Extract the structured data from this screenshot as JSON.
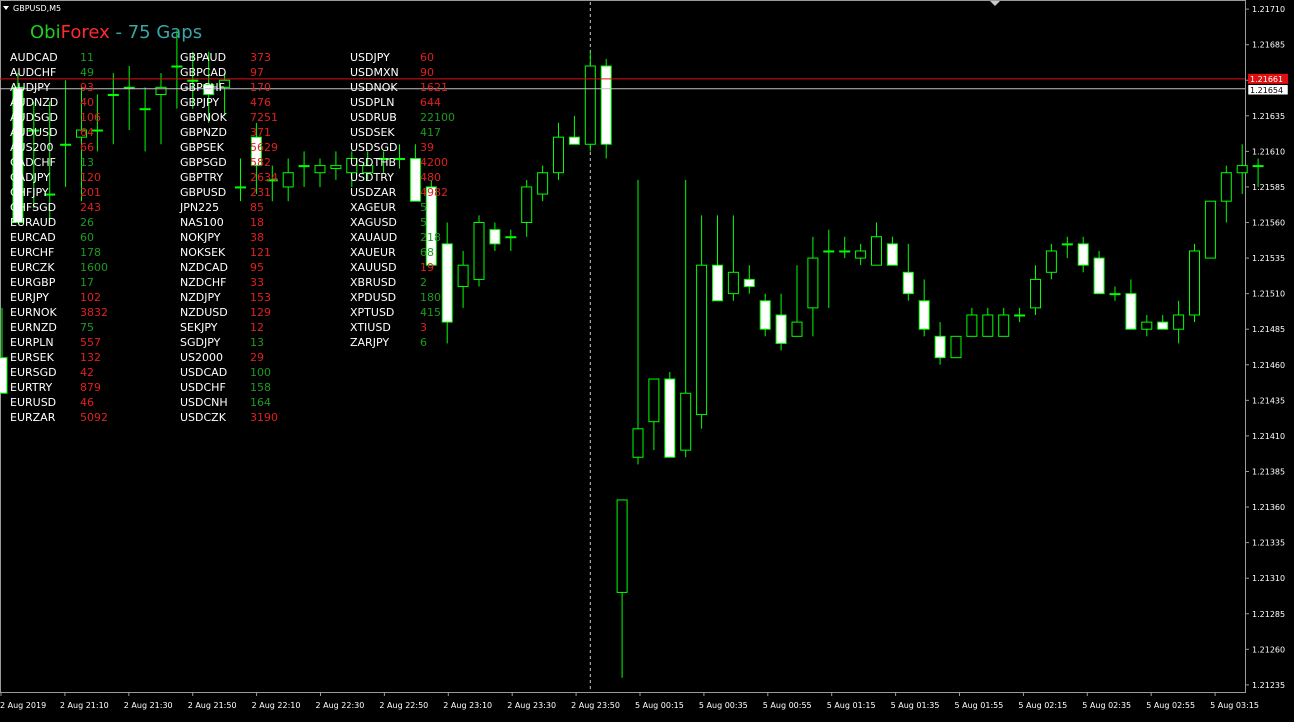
{
  "window": {
    "title": "GBPUSD,M5"
  },
  "overlay": {
    "title_part1": "Obi",
    "title_part2": "Forex",
    "title_part3": " - 75 Gaps",
    "colors": {
      "obi": "#22cc22",
      "forex": "#ff2b2b",
      "gaps": "#3aa6a6",
      "positive": "#1e9b1e",
      "negative": "#e02020",
      "symbol": "#ffffff"
    },
    "columns": [
      [
        {
          "symbol": "AUDCAD",
          "gap": "11",
          "dir": "up"
        },
        {
          "symbol": "AUDCHF",
          "gap": "49",
          "dir": "up"
        },
        {
          "symbol": "AUDJPY",
          "gap": "93",
          "dir": "down"
        },
        {
          "symbol": "AUDNZD",
          "gap": "40",
          "dir": "down"
        },
        {
          "symbol": "AUDSGD",
          "gap": "106",
          "dir": "down"
        },
        {
          "symbol": "AUDUSD",
          "gap": "64",
          "dir": "down"
        },
        {
          "symbol": "AUS200",
          "gap": "66",
          "dir": "down"
        },
        {
          "symbol": "CADCHF",
          "gap": "13",
          "dir": "up"
        },
        {
          "symbol": "CADJPY",
          "gap": "120",
          "dir": "down"
        },
        {
          "symbol": "CHFJPY",
          "gap": "201",
          "dir": "down"
        },
        {
          "symbol": "CHFSGD",
          "gap": "243",
          "dir": "down"
        },
        {
          "symbol": "EURAUD",
          "gap": "26",
          "dir": "up"
        },
        {
          "symbol": "EURCAD",
          "gap": "60",
          "dir": "up"
        },
        {
          "symbol": "EURCHF",
          "gap": "178",
          "dir": "up"
        },
        {
          "symbol": "EURCZK",
          "gap": "1600",
          "dir": "up"
        },
        {
          "symbol": "EURGBP",
          "gap": "17",
          "dir": "up"
        },
        {
          "symbol": "EURJPY",
          "gap": "102",
          "dir": "down"
        },
        {
          "symbol": "EURNOK",
          "gap": "3832",
          "dir": "down"
        },
        {
          "symbol": "EURNZD",
          "gap": "75",
          "dir": "up"
        },
        {
          "symbol": "EURPLN",
          "gap": "557",
          "dir": "down"
        },
        {
          "symbol": "EURSEK",
          "gap": "132",
          "dir": "down"
        },
        {
          "symbol": "EURSGD",
          "gap": "42",
          "dir": "down"
        },
        {
          "symbol": "EURTRY",
          "gap": "879",
          "dir": "down"
        },
        {
          "symbol": "EURUSD",
          "gap": "46",
          "dir": "down"
        },
        {
          "symbol": "EURZAR",
          "gap": "5092",
          "dir": "down"
        }
      ],
      [
        {
          "symbol": "GBPAUD",
          "gap": "373",
          "dir": "down"
        },
        {
          "symbol": "GBPCAD",
          "gap": "97",
          "dir": "down"
        },
        {
          "symbol": "GBPCHF",
          "gap": "170",
          "dir": "down"
        },
        {
          "symbol": "GBPJPY",
          "gap": "476",
          "dir": "down"
        },
        {
          "symbol": "GBPNOK",
          "gap": "7251",
          "dir": "down"
        },
        {
          "symbol": "GBPNZD",
          "gap": "371",
          "dir": "down"
        },
        {
          "symbol": "GBPSEK",
          "gap": "5629",
          "dir": "down"
        },
        {
          "symbol": "GBPSGD",
          "gap": "582",
          "dir": "down"
        },
        {
          "symbol": "GBPTRY",
          "gap": "2634",
          "dir": "down"
        },
        {
          "symbol": "GBPUSD",
          "gap": "231",
          "dir": "down"
        },
        {
          "symbol": "JPN225",
          "gap": "85",
          "dir": "down"
        },
        {
          "symbol": "NAS100",
          "gap": "18",
          "dir": "down"
        },
        {
          "symbol": "NOKJPY",
          "gap": "38",
          "dir": "down"
        },
        {
          "symbol": "NOKSEK",
          "gap": "121",
          "dir": "down"
        },
        {
          "symbol": "NZDCAD",
          "gap": "95",
          "dir": "down"
        },
        {
          "symbol": "NZDCHF",
          "gap": "33",
          "dir": "down"
        },
        {
          "symbol": "NZDJPY",
          "gap": "153",
          "dir": "down"
        },
        {
          "symbol": "NZDUSD",
          "gap": "129",
          "dir": "down"
        },
        {
          "symbol": "SEKJPY",
          "gap": "12",
          "dir": "down"
        },
        {
          "symbol": "SGDJPY",
          "gap": "13",
          "dir": "up"
        },
        {
          "symbol": "US2000",
          "gap": "29",
          "dir": "down"
        },
        {
          "symbol": "USDCAD",
          "gap": "100",
          "dir": "up"
        },
        {
          "symbol": "USDCHF",
          "gap": "158",
          "dir": "up"
        },
        {
          "symbol": "USDCNH",
          "gap": "164",
          "dir": "up"
        },
        {
          "symbol": "USDCZK",
          "gap": "3190",
          "dir": "down"
        }
      ],
      [
        {
          "symbol": "USDJPY",
          "gap": "60",
          "dir": "down"
        },
        {
          "symbol": "USDMXN",
          "gap": "90",
          "dir": "down"
        },
        {
          "symbol": "USDNOK",
          "gap": "1621",
          "dir": "down"
        },
        {
          "symbol": "USDPLN",
          "gap": "644",
          "dir": "down"
        },
        {
          "symbol": "USDRUB",
          "gap": "22100",
          "dir": "up"
        },
        {
          "symbol": "USDSEK",
          "gap": "417",
          "dir": "up"
        },
        {
          "symbol": "USDSGD",
          "gap": "39",
          "dir": "down"
        },
        {
          "symbol": "USDTHB",
          "gap": "4200",
          "dir": "down"
        },
        {
          "symbol": "USDTRY",
          "gap": "480",
          "dir": "down"
        },
        {
          "symbol": "USDZAR",
          "gap": "4982",
          "dir": "down"
        },
        {
          "symbol": "XAGEUR",
          "gap": "5",
          "dir": "up"
        },
        {
          "symbol": "XAGUSD",
          "gap": "5",
          "dir": "up"
        },
        {
          "symbol": "XAUAUD",
          "gap": "218",
          "dir": "up"
        },
        {
          "symbol": "XAUEUR",
          "gap": "68",
          "dir": "up"
        },
        {
          "symbol": "XAUUSD",
          "gap": "19",
          "dir": "down"
        },
        {
          "symbol": "XBRUSD",
          "gap": "2",
          "dir": "up"
        },
        {
          "symbol": "XPDUSD",
          "gap": "180",
          "dir": "up"
        },
        {
          "symbol": "XPTUSD",
          "gap": "415",
          "dir": "up"
        },
        {
          "symbol": "XTIUSD",
          "gap": "3",
          "dir": "down"
        },
        {
          "symbol": "ZARJPY",
          "gap": "6",
          "dir": "up"
        }
      ]
    ]
  },
  "price_labels": {
    "bid": "1.21661",
    "last": "1.21654",
    "bid_color": "#e01010",
    "last_color": "#ffffff"
  },
  "chart_data": {
    "type": "candlestick",
    "symbol": "GBPUSD",
    "timeframe": "M5",
    "bull_color": "#000000",
    "bear_color": "#ffffff",
    "wick_color": "#00ff00",
    "ylim": [
      1.2123,
      1.21715
    ],
    "y_ticks": [
      "1.21235",
      "1.21260",
      "1.21285",
      "1.21310",
      "1.21335",
      "1.21360",
      "1.21385",
      "1.21410",
      "1.21435",
      "1.21460",
      "1.21485",
      "1.21510",
      "1.21535",
      "1.21560",
      "1.21585",
      "1.21610",
      "1.21635",
      "1.21660",
      "1.21685",
      "1.21710"
    ],
    "x_ticks": [
      "2 Aug 2019",
      "2 Aug 21:10",
      "2 Aug 21:30",
      "2 Aug 21:50",
      "2 Aug 22:10",
      "2 Aug 22:30",
      "2 Aug 22:50",
      "2 Aug 23:10",
      "2 Aug 23:30",
      "2 Aug 23:50",
      "5 Aug 00:15",
      "5 Aug 00:35",
      "5 Aug 00:55",
      "5 Aug 01:15",
      "5 Aug 01:35",
      "5 Aug 01:55",
      "5 Aug 02:15",
      "5 Aug 02:35",
      "5 Aug 02:55",
      "5 Aug 03:15"
    ],
    "separator_time": "5 Aug 00:00",
    "candles": [
      {
        "o": 1.21465,
        "h": 1.215,
        "l": 1.2144,
        "c": 1.2144
      },
      {
        "o": 1.21655,
        "h": 1.21665,
        "l": 1.2156,
        "c": 1.2156
      },
      {
        "o": 1.21625,
        "h": 1.21645,
        "l": 1.2157,
        "c": 1.21625
      },
      {
        "o": 1.2158,
        "h": 1.21645,
        "l": 1.2156,
        "c": 1.2158
      },
      {
        "o": 1.21615,
        "h": 1.2166,
        "l": 1.21585,
        "c": 1.21615
      },
      {
        "o": 1.2162,
        "h": 1.21655,
        "l": 1.21575,
        "c": 1.21625
      },
      {
        "o": 1.21625,
        "h": 1.2165,
        "l": 1.2161,
        "c": 1.21625
      },
      {
        "o": 1.2165,
        "h": 1.21665,
        "l": 1.21615,
        "c": 1.2165
      },
      {
        "o": 1.21655,
        "h": 1.2167,
        "l": 1.21625,
        "c": 1.21655
      },
      {
        "o": 1.2164,
        "h": 1.21655,
        "l": 1.2161,
        "c": 1.2164
      },
      {
        "o": 1.2165,
        "h": 1.21665,
        "l": 1.21615,
        "c": 1.21655
      },
      {
        "o": 1.2167,
        "h": 1.21695,
        "l": 1.2164,
        "c": 1.2167
      },
      {
        "o": 1.2166,
        "h": 1.2168,
        "l": 1.2164,
        "c": 1.2166
      },
      {
        "o": 1.21657,
        "h": 1.2168,
        "l": 1.2163,
        "c": 1.2165
      },
      {
        "o": 1.21655,
        "h": 1.21665,
        "l": 1.21635,
        "c": 1.2166
      },
      {
        "o": 1.21585,
        "h": 1.21605,
        "l": 1.21575,
        "c": 1.21585
      },
      {
        "o": 1.2162,
        "h": 1.2163,
        "l": 1.2158,
        "c": 1.216
      },
      {
        "o": 1.2159,
        "h": 1.216,
        "l": 1.21575,
        "c": 1.2159
      },
      {
        "o": 1.21585,
        "h": 1.21605,
        "l": 1.21575,
        "c": 1.21595
      },
      {
        "o": 1.216,
        "h": 1.2161,
        "l": 1.21585,
        "c": 1.216
      },
      {
        "o": 1.21595,
        "h": 1.21605,
        "l": 1.21585,
        "c": 1.216
      },
      {
        "o": 1.21598,
        "h": 1.2161,
        "l": 1.2159,
        "c": 1.216
      },
      {
        "o": 1.21595,
        "h": 1.2161,
        "l": 1.21585,
        "c": 1.21605
      },
      {
        "o": 1.21595,
        "h": 1.2161,
        "l": 1.2159,
        "c": 1.216
      },
      {
        "o": 1.21605,
        "h": 1.2161,
        "l": 1.21595,
        "c": 1.21605
      },
      {
        "o": 1.21605,
        "h": 1.21615,
        "l": 1.21598,
        "c": 1.21605
      },
      {
        "o": 1.21605,
        "h": 1.21615,
        "l": 1.2158,
        "c": 1.21575
      },
      {
        "o": 1.21585,
        "h": 1.2159,
        "l": 1.2153,
        "c": 1.2153
      },
      {
        "o": 1.21545,
        "h": 1.2156,
        "l": 1.21475,
        "c": 1.2149
      },
      {
        "o": 1.21515,
        "h": 1.2154,
        "l": 1.215,
        "c": 1.2153
      },
      {
        "o": 1.2152,
        "h": 1.21565,
        "l": 1.21515,
        "c": 1.2156
      },
      {
        "o": 1.21555,
        "h": 1.2156,
        "l": 1.2154,
        "c": 1.21545
      },
      {
        "o": 1.2155,
        "h": 1.21555,
        "l": 1.2154,
        "c": 1.2155
      },
      {
        "o": 1.2156,
        "h": 1.2159,
        "l": 1.2155,
        "c": 1.21585
      },
      {
        "o": 1.2158,
        "h": 1.216,
        "l": 1.21575,
        "c": 1.21595
      },
      {
        "o": 1.21595,
        "h": 1.2163,
        "l": 1.2159,
        "c": 1.2162
      },
      {
        "o": 1.2162,
        "h": 1.21635,
        "l": 1.21615,
        "c": 1.21615
      },
      {
        "o": 1.21615,
        "h": 1.2168,
        "l": 1.2161,
        "c": 1.2167
      },
      {
        "o": 1.2167,
        "h": 1.21675,
        "l": 1.21605,
        "c": 1.21615
      },
      {
        "o": 1.213,
        "h": 1.21365,
        "l": 1.2124,
        "c": 1.21365
      },
      {
        "o": 1.21395,
        "h": 1.2159,
        "l": 1.2139,
        "c": 1.21415
      },
      {
        "o": 1.2142,
        "h": 1.2145,
        "l": 1.214,
        "c": 1.2145
      },
      {
        "o": 1.2145,
        "h": 1.21455,
        "l": 1.21395,
        "c": 1.21395
      },
      {
        "o": 1.214,
        "h": 1.2159,
        "l": 1.21395,
        "c": 1.2144
      },
      {
        "o": 1.21425,
        "h": 1.21565,
        "l": 1.21415,
        "c": 1.2153
      },
      {
        "o": 1.2153,
        "h": 1.21565,
        "l": 1.2151,
        "c": 1.21505
      },
      {
        "o": 1.2151,
        "h": 1.21565,
        "l": 1.21505,
        "c": 1.21525
      },
      {
        "o": 1.2152,
        "h": 1.2153,
        "l": 1.2151,
        "c": 1.21515
      },
      {
        "o": 1.21505,
        "h": 1.2151,
        "l": 1.2148,
        "c": 1.21485
      },
      {
        "o": 1.21495,
        "h": 1.2151,
        "l": 1.2147,
        "c": 1.21475
      },
      {
        "o": 1.2148,
        "h": 1.2153,
        "l": 1.2148,
        "c": 1.2149
      },
      {
        "o": 1.215,
        "h": 1.2155,
        "l": 1.2148,
        "c": 1.21535
      },
      {
        "o": 1.2154,
        "h": 1.21555,
        "l": 1.215,
        "c": 1.2154
      },
      {
        "o": 1.2154,
        "h": 1.2155,
        "l": 1.21535,
        "c": 1.2154
      },
      {
        "o": 1.21535,
        "h": 1.21545,
        "l": 1.2153,
        "c": 1.2154
      },
      {
        "o": 1.2153,
        "h": 1.2156,
        "l": 1.2153,
        "c": 1.2155
      },
      {
        "o": 1.21545,
        "h": 1.2155,
        "l": 1.2153,
        "c": 1.2153
      },
      {
        "o": 1.21525,
        "h": 1.21545,
        "l": 1.21505,
        "c": 1.2151
      },
      {
        "o": 1.21505,
        "h": 1.2152,
        "l": 1.2148,
        "c": 1.21485
      },
      {
        "o": 1.2148,
        "h": 1.2149,
        "l": 1.2146,
        "c": 1.21465
      },
      {
        "o": 1.21465,
        "h": 1.2148,
        "l": 1.21465,
        "c": 1.2148
      },
      {
        "o": 1.2148,
        "h": 1.215,
        "l": 1.2148,
        "c": 1.21495
      },
      {
        "o": 1.2148,
        "h": 1.215,
        "l": 1.2148,
        "c": 1.21495
      },
      {
        "o": 1.2148,
        "h": 1.215,
        "l": 1.2148,
        "c": 1.21495
      },
      {
        "o": 1.21495,
        "h": 1.215,
        "l": 1.2149,
        "c": 1.21495
      },
      {
        "o": 1.215,
        "h": 1.2153,
        "l": 1.21495,
        "c": 1.2152
      },
      {
        "o": 1.21525,
        "h": 1.21545,
        "l": 1.2152,
        "c": 1.2154
      },
      {
        "o": 1.21545,
        "h": 1.2155,
        "l": 1.21535,
        "c": 1.21545
      },
      {
        "o": 1.21545,
        "h": 1.2155,
        "l": 1.21525,
        "c": 1.2153
      },
      {
        "o": 1.21535,
        "h": 1.2154,
        "l": 1.2151,
        "c": 1.2151
      },
      {
        "o": 1.2151,
        "h": 1.21515,
        "l": 1.21505,
        "c": 1.2151
      },
      {
        "o": 1.2151,
        "h": 1.2152,
        "l": 1.21485,
        "c": 1.21485
      },
      {
        "o": 1.21485,
        "h": 1.21495,
        "l": 1.2148,
        "c": 1.2149
      },
      {
        "o": 1.2149,
        "h": 1.21495,
        "l": 1.21485,
        "c": 1.21485
      },
      {
        "o": 1.21485,
        "h": 1.21505,
        "l": 1.21475,
        "c": 1.21495
      },
      {
        "o": 1.21495,
        "h": 1.21545,
        "l": 1.2149,
        "c": 1.2154
      },
      {
        "o": 1.21535,
        "h": 1.21575,
        "l": 1.21535,
        "c": 1.21575
      },
      {
        "o": 1.21575,
        "h": 1.216,
        "l": 1.2156,
        "c": 1.21595
      },
      {
        "o": 1.21595,
        "h": 1.21615,
        "l": 1.2158,
        "c": 1.216
      },
      {
        "o": 1.216,
        "h": 1.21605,
        "l": 1.21585,
        "c": 1.216
      }
    ]
  }
}
